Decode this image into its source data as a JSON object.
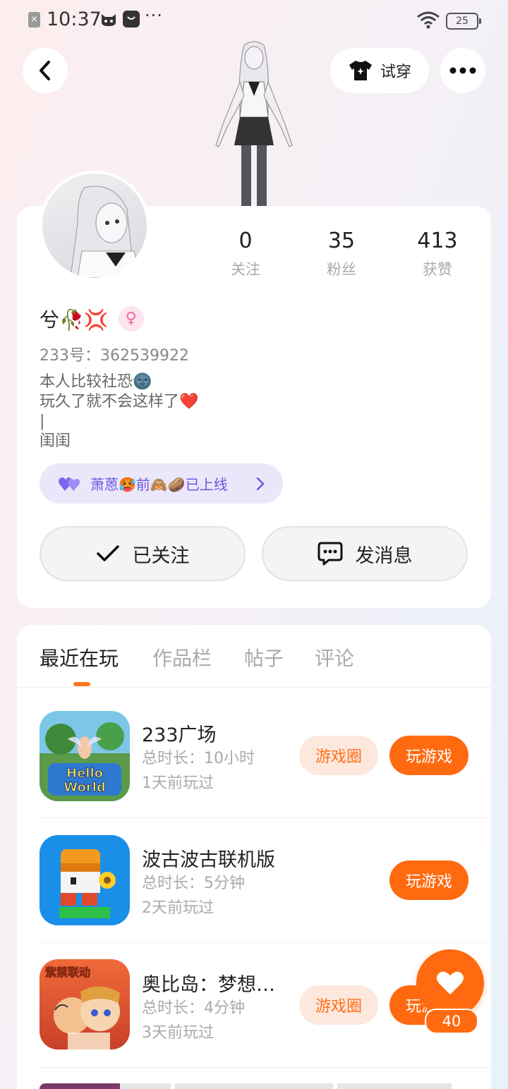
{
  "status_bar": {
    "time": "10:37",
    "dots": "···",
    "battery": "25"
  },
  "header": {
    "try_on_label": "试穿"
  },
  "profile": {
    "stats": [
      {
        "value": "0",
        "label": "关注"
      },
      {
        "value": "35",
        "label": "粉丝"
      },
      {
        "value": "413",
        "label": "获赞"
      }
    ],
    "username": "兮🥀💢",
    "gender_symbol": "♀",
    "user_id": "233号：362539922",
    "bio_lines": [
      "本人比较社恐🌚",
      "玩久了就不会这样了❤️",
      "|",
      "闺闺"
    ],
    "fanclub_text": "萧蒽🥵前🙈🥔已上线",
    "followed_label": "已关注",
    "message_label": "发消息"
  },
  "tabs": [
    {
      "label": "最近在玩",
      "active": true
    },
    {
      "label": "作品栏",
      "active": false
    },
    {
      "label": "帖子",
      "active": false
    },
    {
      "label": "评论",
      "active": false
    }
  ],
  "games": [
    {
      "title": "233广场",
      "duration": "总时长：10小时",
      "last_played": "1天前玩过",
      "has_circle": true,
      "circle_label": "游戏圈",
      "play_label": "玩游戏",
      "icon_text": "Hello World"
    },
    {
      "title": "波古波古联机版",
      "duration": "总时长：5分钟",
      "last_played": "2天前玩过",
      "has_circle": false,
      "play_label": "玩游戏"
    },
    {
      "title": "奥比岛：梦想…",
      "duration": "总时长：4分钟",
      "last_played": "3天前玩过",
      "has_circle": true,
      "circle_label": "游戏圈",
      "play_label": "玩游戏",
      "icon_text": "紫禁联动"
    }
  ],
  "like": {
    "count": "40"
  },
  "colors": {
    "accent": "#ff6a10",
    "accent_light": "#fde8de",
    "fanclub_bg": "#ebe7fb",
    "fanclub_text": "#6a58e0"
  }
}
